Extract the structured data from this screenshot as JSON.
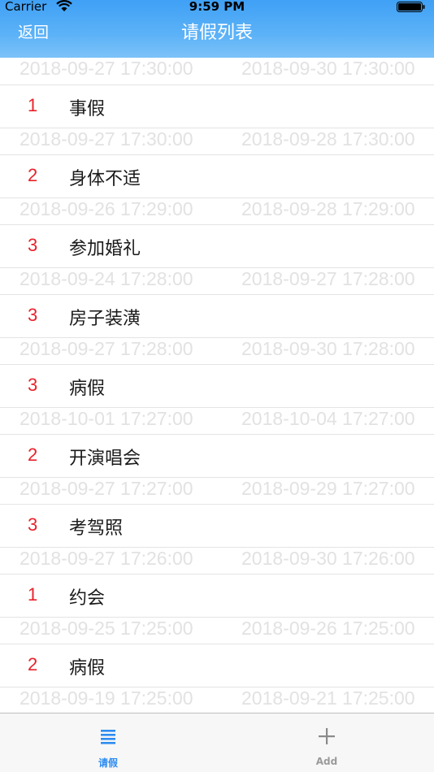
{
  "status_bar": {
    "carrier": "Carrier",
    "time": "9:59 PM"
  },
  "nav": {
    "back_label": "返回",
    "title": "请假列表"
  },
  "first_dates": {
    "start": "2018-09-27 17:30:00",
    "end": "2018-09-30 17:30:00"
  },
  "items": [
    {
      "days": "1",
      "reason": "事假",
      "start": "2018-09-27 17:30:00",
      "end": "2018-09-28 17:30:00"
    },
    {
      "days": "2",
      "reason": "身体不适",
      "start": "2018-09-26 17:29:00",
      "end": "2018-09-28 17:29:00"
    },
    {
      "days": "3",
      "reason": "参加婚礼",
      "start": "2018-09-24 17:28:00",
      "end": "2018-09-27 17:28:00"
    },
    {
      "days": "3",
      "reason": "房子装潢",
      "start": "2018-09-27 17:28:00",
      "end": "2018-09-30 17:28:00"
    },
    {
      "days": "3",
      "reason": "病假",
      "start": "2018-10-01 17:27:00",
      "end": "2018-10-04 17:27:00"
    },
    {
      "days": "2",
      "reason": "开演唱会",
      "start": "2018-09-27 17:27:00",
      "end": "2018-09-29 17:27:00"
    },
    {
      "days": "3",
      "reason": "考驾照",
      "start": "2018-09-27 17:26:00",
      "end": "2018-09-30 17:26:00"
    },
    {
      "days": "1",
      "reason": "约会",
      "start": "2018-09-25 17:25:00",
      "end": "2018-09-26 17:25:00"
    },
    {
      "days": "2",
      "reason": "病假",
      "start": "2018-09-19 17:25:00",
      "end": "2018-09-21 17:25:00"
    }
  ],
  "tabs": [
    {
      "label": "请假",
      "icon": "list-icon",
      "active": true,
      "color": "#2d8cf0"
    },
    {
      "label": "Add",
      "icon": "plus-icon",
      "active": false,
      "color": "#9a9a9a"
    }
  ],
  "colors": {
    "header": "#4aa8f6",
    "day_count": "#e8222a",
    "date_text": "#e2e2e2"
  }
}
